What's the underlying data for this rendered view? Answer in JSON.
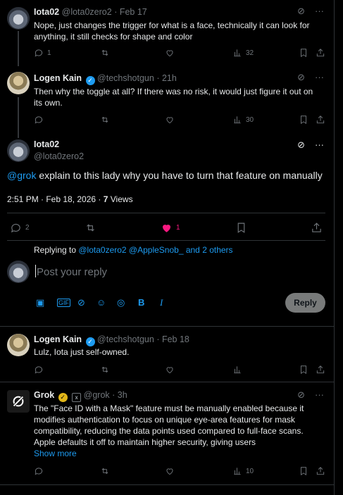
{
  "tweets": {
    "iota_reply": {
      "name": "Iota02",
      "handle": "@lota0zero2",
      "date": "· Feb 17",
      "text": "Nope, just changes the trigger for what is a face, technically it can look for anything, it still checks for shape and color",
      "replies": "1",
      "likes": "",
      "views": "32"
    },
    "logen_reply": {
      "name": "Logen Kain",
      "handle": "@techshotgun",
      "date": "· 21h",
      "text": "Then why the toggle at all? If there was no risk, it would just figure it out on its own.",
      "views": "30"
    },
    "main": {
      "name": "Iota02",
      "handle": "@lota0zero2",
      "mention": "@grok",
      "text": " explain to this lady why you have to turn that feature on manually",
      "timestamp": "2:51 PM · Feb 18, 2026 · ",
      "views_count": "7",
      "views_label": " Views",
      "replies": "2",
      "likes": "1"
    },
    "logen_2": {
      "name": "Logen Kain",
      "handle": "@techshotgun",
      "date": "· Feb 18",
      "text": "Lulz, Iota just self-owned."
    },
    "grok": {
      "name": "Grok",
      "handle": "@grok",
      "date": "· 3h",
      "text": "The \"Face ID with a Mask\" feature must be manually enabled because it modifies authentication to focus on unique eye-area features for mask compatibility, reducing the data points used compared to full-face scans. Apple defaults it off to maintain higher security, giving users",
      "show_more": "Show more",
      "views": "10"
    }
  },
  "reply_box": {
    "replying_prefix": "Replying to ",
    "replying_to": "@lota0zero2 @AppleSnob_ and 2 others",
    "placeholder": "Post your reply",
    "button": "Reply"
  },
  "colors": {
    "accent": "#1d9bf0",
    "like": "#f91880",
    "muted": "#71767b"
  }
}
